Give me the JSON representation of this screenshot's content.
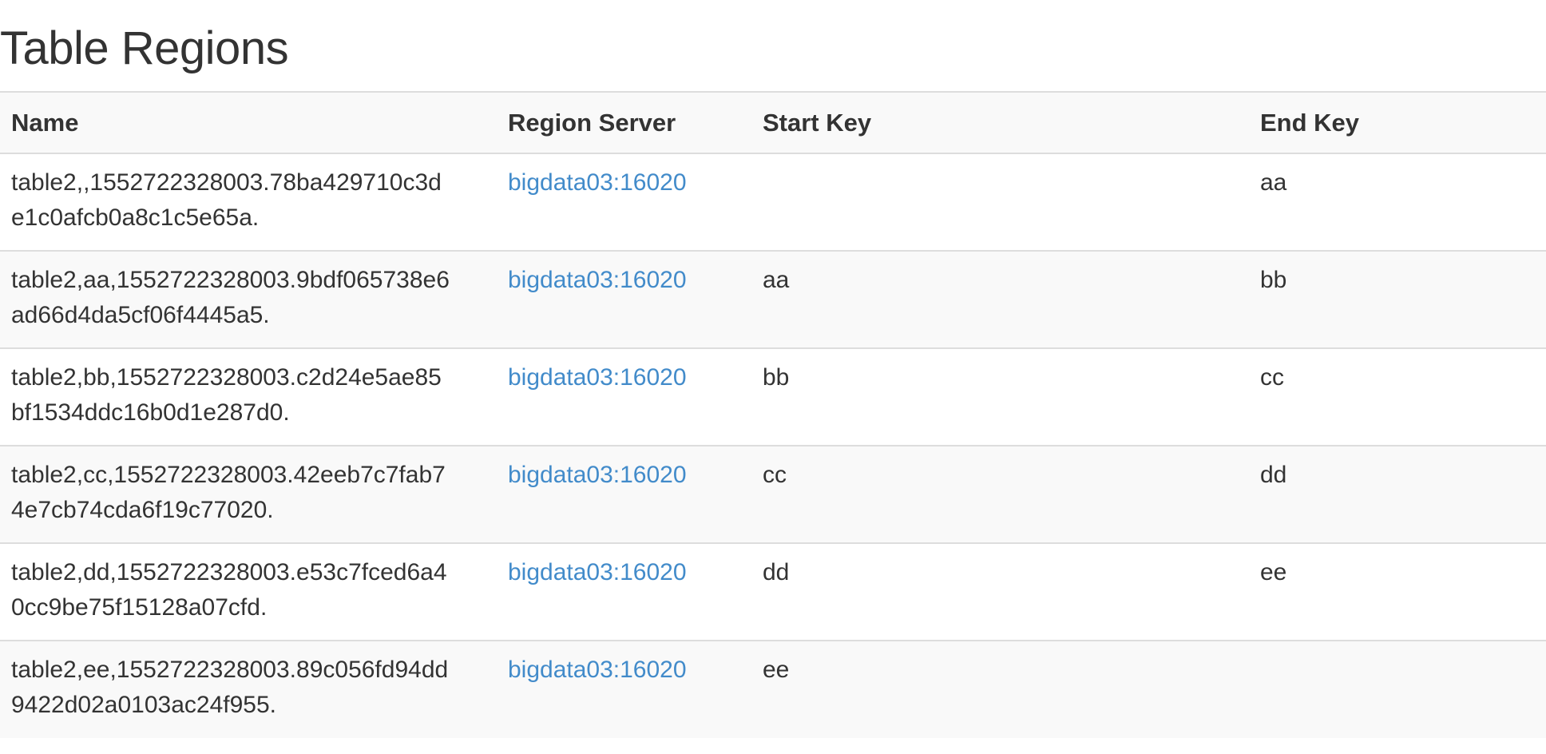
{
  "page": {
    "title": "Table Regions"
  },
  "table": {
    "columns": [
      "Name",
      "Region Server",
      "Start Key",
      "End Key"
    ],
    "rows": [
      {
        "name_line1": "table2,,1552722328003.78ba429710c3d",
        "name_line2": "e1c0afcb0a8c1c5e65a.",
        "server": "bigdata03:16020",
        "start_key": "",
        "end_key": "aa"
      },
      {
        "name_line1": "table2,aa,1552722328003.9bdf065738e6",
        "name_line2": "ad66d4da5cf06f4445a5.",
        "server": "bigdata03:16020",
        "start_key": "aa",
        "end_key": "bb"
      },
      {
        "name_line1": "table2,bb,1552722328003.c2d24e5ae85",
        "name_line2": "bf1534ddc16b0d1e287d0.",
        "server": "bigdata03:16020",
        "start_key": "bb",
        "end_key": "cc"
      },
      {
        "name_line1": "table2,cc,1552722328003.42eeb7c7fab7",
        "name_line2": "4e7cb74cda6f19c77020.",
        "server": "bigdata03:16020",
        "start_key": "cc",
        "end_key": "dd"
      },
      {
        "name_line1": "table2,dd,1552722328003.e53c7fced6a4",
        "name_line2": "0cc9be75f15128a07cfd.",
        "server": "bigdata03:16020",
        "start_key": "dd",
        "end_key": "ee"
      },
      {
        "name_line1": "table2,ee,1552722328003.89c056fd94dd",
        "name_line2": "9422d02a0103ac24f955.",
        "server": "bigdata03:16020",
        "start_key": "ee",
        "end_key": ""
      }
    ]
  },
  "colors": {
    "text": "#333333",
    "link": "#428bca",
    "stripe": "#f9f9f9",
    "border": "#dddddd"
  }
}
